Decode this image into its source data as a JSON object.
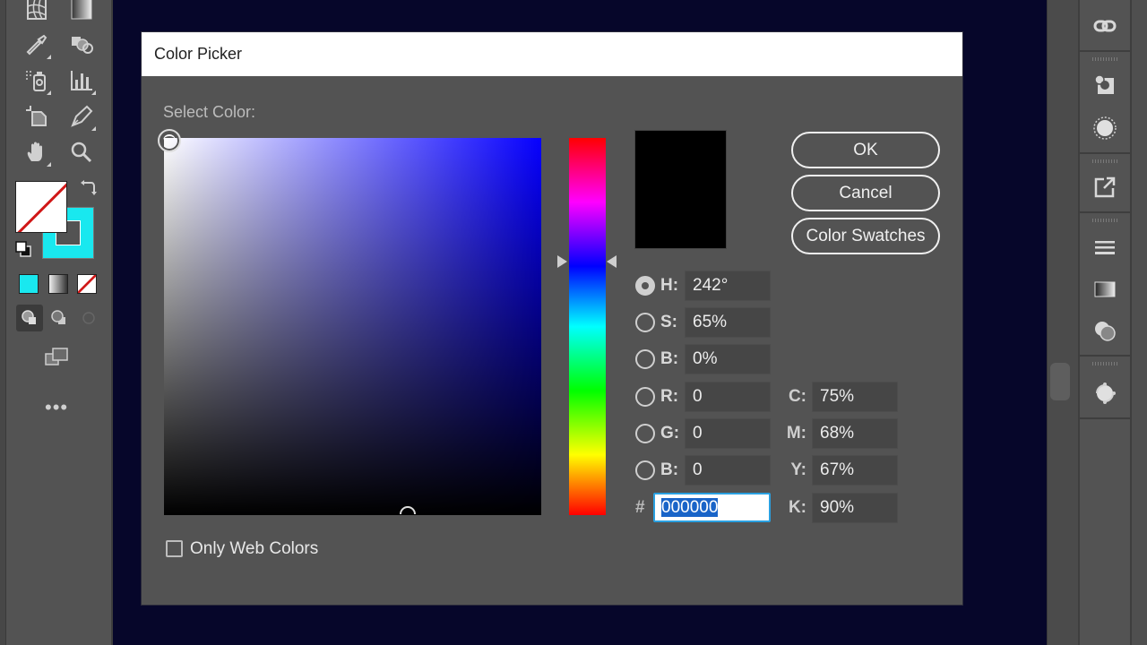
{
  "dialog": {
    "title": "Color Picker",
    "select_color_label": "Select Color:",
    "buttons": {
      "ok": "OK",
      "cancel": "Cancel",
      "color_swatches": "Color Swatches"
    },
    "current_color_hex": "#000000",
    "hue_fraction": 0.672,
    "hsb": [
      {
        "label": "H:",
        "value": "242°",
        "selected": true
      },
      {
        "label": "S:",
        "value": "65%",
        "selected": false
      },
      {
        "label": "B:",
        "value": "0%",
        "selected": false
      }
    ],
    "rgb": [
      {
        "label": "R:",
        "value": "0",
        "selected": false
      },
      {
        "label": "G:",
        "value": "0",
        "selected": false
      },
      {
        "label": "B:",
        "value": "0",
        "selected": false
      }
    ],
    "cmyk": [
      {
        "label": "C:",
        "value": "75%"
      },
      {
        "label": "M:",
        "value": "68%"
      },
      {
        "label": "Y:",
        "value": "67%"
      },
      {
        "label": "K:",
        "value": "90%"
      }
    ],
    "hex_label": "#",
    "hex_value": "000000",
    "only_web_colors_label": "Only Web Colors",
    "only_web_colors_checked": false
  },
  "toolbar": {
    "tools": [
      "mesh-tool",
      "gradient-tool",
      "eyedropper-tool",
      "shape-builder-tool",
      "symbol-sprayer-tool",
      "column-graph-tool",
      "artboard-tool",
      "pencil-tool",
      "hand-tool",
      "zoom-tool"
    ],
    "fill": "none",
    "stroke_color": "#19e8ef",
    "more_label": "•••"
  },
  "right_panel": {
    "icons": [
      "links-icon",
      "appearance-icon",
      "brushes-icon",
      "export-icon",
      "align-icon",
      "gradient-panel-icon",
      "transparency-icon",
      "color-guide-icon"
    ]
  },
  "colors": {
    "canvas": "#06062a",
    "panel": "#535353",
    "field_hue": "#0600ff"
  }
}
